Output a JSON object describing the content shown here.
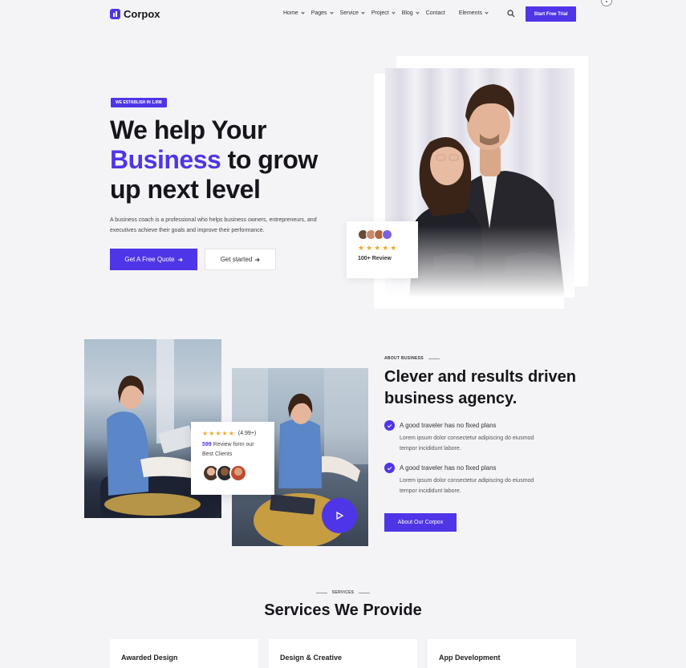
{
  "brand": {
    "name": "Corpox",
    "accent": "#4f35e8"
  },
  "nav": {
    "items": [
      {
        "label": "Home",
        "dropdown": true
      },
      {
        "label": "Pages",
        "dropdown": true
      },
      {
        "label": "Service",
        "dropdown": true
      },
      {
        "label": "Project",
        "dropdown": true
      },
      {
        "label": "Blog",
        "dropdown": true
      },
      {
        "label": "Contact",
        "dropdown": false
      },
      {
        "label": "Elements",
        "dropdown": true
      }
    ],
    "search_icon": "search-icon",
    "cta_label": "Start Free Trial"
  },
  "hero": {
    "badge": "WE ESTABLISH IN 1,998",
    "title_line1": "We help Your",
    "title_accent": "Business",
    "title_line2_rest": " to grow",
    "title_line3": "up next level",
    "description": "A business coach is a professional who helps business owners, entrepreneurs, and executives achieve their goals and improve their performance.",
    "primary_button": "Get A Free Quote",
    "secondary_button": "Get started",
    "review_card": {
      "stars": "★★★★★",
      "label": "100+ Review"
    }
  },
  "about": {
    "eyebrow": "ABOUT BUSINESS",
    "title": "Clever and results driven business agency.",
    "features": [
      {
        "title": "A good traveler has no fixed plans",
        "desc": "Lorem ipsum dolor consectetur adipiscing do eiusmod tempor incididunt labore."
      },
      {
        "title": "A good traveler has no fixed plans",
        "desc": "Lorem ipsum dolor consectetur adipiscing do eiusmod tempor incididunt labore."
      }
    ],
    "button": "About Our Corpox",
    "rating_card": {
      "stars": "★★★★★",
      "score": "(4.99+)",
      "count": "599",
      "text": " Review form our Best Clients"
    }
  },
  "services": {
    "eyebrow": "SERVICES",
    "title": "Services We Provide",
    "cards": [
      "Awarded Design",
      "Design & Creative",
      "App Development"
    ]
  }
}
